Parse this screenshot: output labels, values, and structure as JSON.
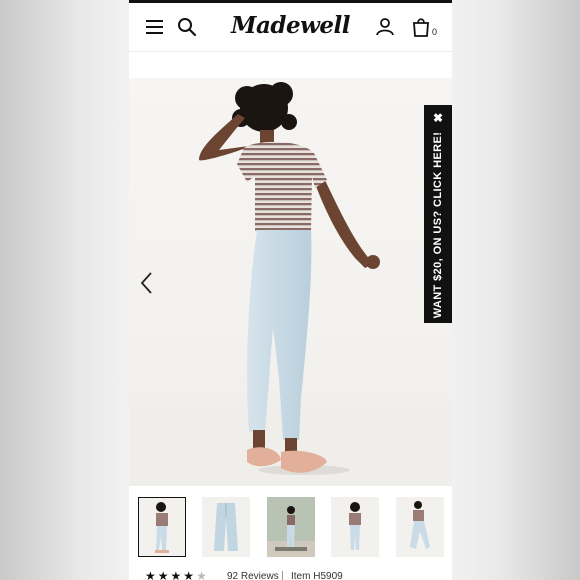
{
  "header": {
    "logo_text": "Madewell",
    "bag_count": "0",
    "icons": [
      "menu-icon",
      "search-icon",
      "account-icon",
      "bag-icon"
    ]
  },
  "promo": {
    "text": "WANT $20, ON US? CLICK HERE!",
    "close_glyph": "✖"
  },
  "gallery": {
    "thumbnail_count": 5,
    "selected_index": 0
  },
  "product": {
    "rating": 4,
    "rating_max": 5,
    "reviews_label": "92 Reviews",
    "item_label": "Item H5909"
  },
  "colors": {
    "promo_background": "#111111",
    "promo_text": "#ffffff",
    "shirt_stripe_a": "#8a6a66",
    "shirt_stripe_b": "#e8e2dc",
    "denim": "#c9dbe6",
    "sandal": "#e2b09a"
  }
}
